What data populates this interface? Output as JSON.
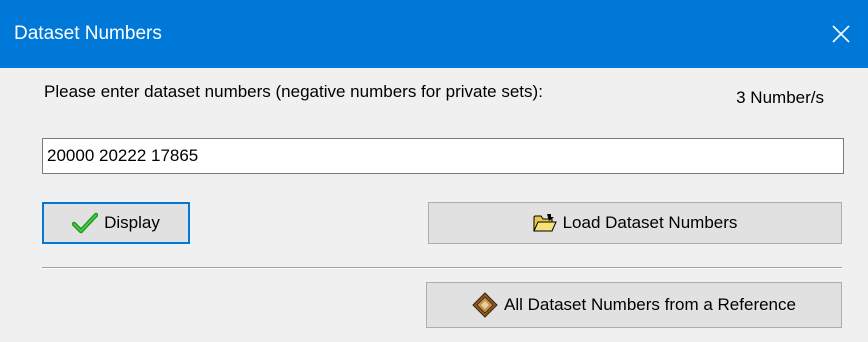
{
  "window": {
    "title": "Dataset Numbers",
    "close_label": "✕"
  },
  "form": {
    "prompt": "Please enter dataset numbers (negative numbers for private sets):",
    "count_text": "3 Number/s",
    "input_value": "20000 20222 17865"
  },
  "buttons": {
    "display_label": "Display",
    "load_label": "Load Dataset Numbers",
    "reference_label": "All Dataset Numbers from a Reference"
  },
  "colors": {
    "titlebar": "#0078d7",
    "button_face": "#e1e1e1",
    "focus_border": "#0078d7"
  },
  "icons": {
    "display": "checkmark-icon",
    "load": "open-folder-icon",
    "reference": "book-icon",
    "close": "close-icon"
  }
}
